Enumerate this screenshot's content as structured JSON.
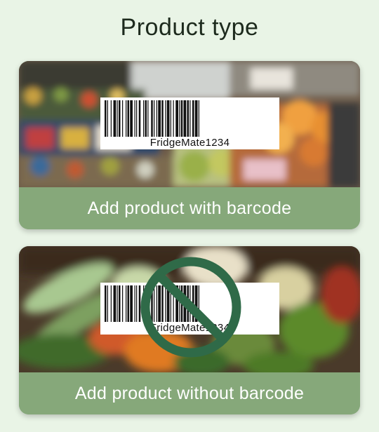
{
  "page": {
    "title": "Product type"
  },
  "options": [
    {
      "label": "Add product with barcode",
      "barcode_text": "FridgeMate1234"
    },
    {
      "label": "Add product without barcode",
      "barcode_text": "FridgeMate1234"
    }
  ],
  "colors": {
    "background": "#e9f4e6",
    "label_bar": "#86a87a",
    "no_sign": "#2f6a48"
  }
}
